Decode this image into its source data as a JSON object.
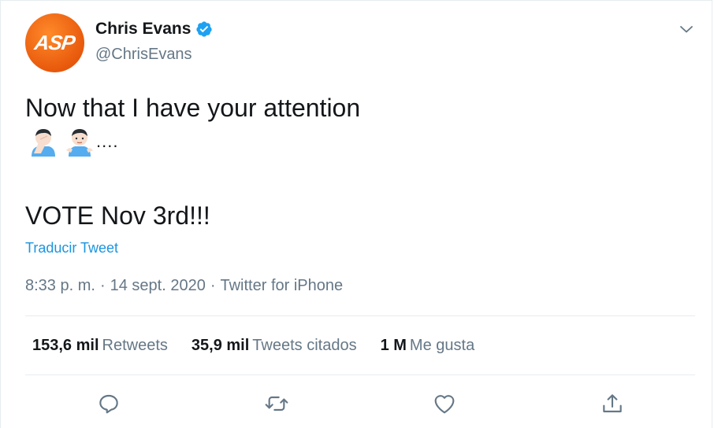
{
  "author": {
    "avatar_text": "ASP",
    "name": "Chris Evans",
    "handle": "@ChrisEvans",
    "verified": true
  },
  "tweet": {
    "line1": "Now that I have your attention",
    "emoji_suffix": "....",
    "line3": "VOTE Nov 3rd!!!",
    "translate_label": "Traducir Tweet"
  },
  "meta": {
    "time": "8:33 p. m.",
    "date": "14 sept. 2020",
    "source": "Twitter for iPhone",
    "separator": "·"
  },
  "stats": {
    "retweets_count": "153,6 mil",
    "retweets_label": "Retweets",
    "quotes_count": "35,9 mil",
    "quotes_label": "Tweets citados",
    "likes_count": "1 M",
    "likes_label": "Me gusta"
  },
  "colors": {
    "link": "#1b95e0",
    "muted": "#657786",
    "text": "#14171a",
    "verified": "#1da1f2",
    "avatar": "#e8590c"
  },
  "icons": [
    "chevron-down-icon",
    "verified-badge-icon",
    "reply-icon",
    "retweet-icon",
    "like-icon",
    "share-icon",
    "facepalm-emoji-icon",
    "shrug-emoji-icon"
  ]
}
